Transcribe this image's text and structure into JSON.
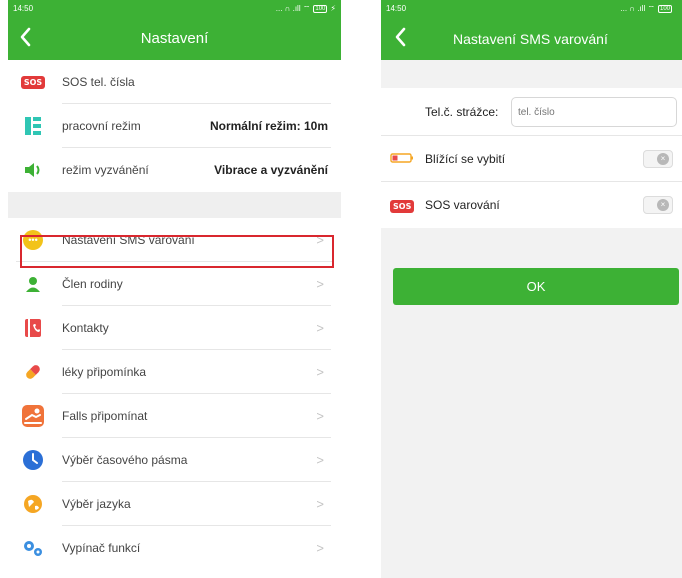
{
  "left_screen": {
    "status": {
      "time": "14:50",
      "icons": "... ∩ .ıll ⌔",
      "battery": "100"
    },
    "header": {
      "title": "Nastavení"
    },
    "items": [
      {
        "label": "SOS tel. čísla",
        "icon": "sos-icon",
        "badge": "SOS"
      },
      {
        "label": "pracovní režim",
        "value": "Normální režim: 10m",
        "icon": "work-mode-icon"
      },
      {
        "label": "režim vyzvánění",
        "value": "Vibrace a vyzvánění",
        "icon": "speaker-icon"
      },
      {
        "label": "Nastavení SMS varování",
        "icon": "sms-bubble-icon"
      },
      {
        "label": "Člen rodiny",
        "icon": "family-member-icon"
      },
      {
        "label": "Kontakty",
        "icon": "contacts-icon"
      },
      {
        "label": "léky připomínka",
        "icon": "pill-icon"
      },
      {
        "label": "Falls připomínat",
        "icon": "fall-icon"
      },
      {
        "label": "Výběr časového pásma",
        "icon": "clock-icon"
      },
      {
        "label": "Výběr jazyka",
        "icon": "globe-icon"
      },
      {
        "label": "Vypínač funkcí",
        "icon": "function-switch-icon"
      }
    ]
  },
  "right_screen": {
    "status": {
      "time": "14:50",
      "icons": "... ∩ .ıll ⌔",
      "battery": "100"
    },
    "header": {
      "title": "Nastavení SMS varování"
    },
    "guardian": {
      "label": "Tel.č. strážce:",
      "placeholder": "tel. číslo",
      "value": ""
    },
    "rows": [
      {
        "label": "Blížící se vybití",
        "icon": "low-battery-icon"
      },
      {
        "label": "SOS varování",
        "icon": "sos-icon",
        "badge": "SOS"
      }
    ],
    "ok_label": "OK"
  },
  "colors": {
    "primary": "#3db135",
    "highlight": "#d9272e",
    "sos": "#e23a3a"
  }
}
